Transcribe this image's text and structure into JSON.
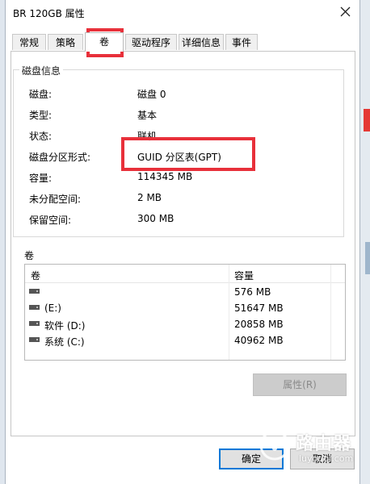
{
  "window": {
    "title": "BR 120GB 属性"
  },
  "tabs": [
    {
      "label": "常规"
    },
    {
      "label": "策略"
    },
    {
      "label": "卷"
    },
    {
      "label": "驱动程序"
    },
    {
      "label": "详细信息"
    },
    {
      "label": "事件"
    }
  ],
  "disk_info": {
    "legend": "磁盘信息",
    "rows": [
      {
        "label": "磁盘:",
        "value": "磁盘 0"
      },
      {
        "label": "类型:",
        "value": "基本"
      },
      {
        "label": "状态:",
        "value": "联机"
      },
      {
        "label": "磁盘分区形式:",
        "value": "GUID 分区表(GPT)"
      },
      {
        "label": "容量:",
        "value": "114345 MB"
      },
      {
        "label": "未分配空间:",
        "value": "2 MB"
      },
      {
        "label": "保留空间:",
        "value": "300 MB"
      }
    ]
  },
  "volumes": {
    "title": "卷",
    "headers": {
      "name": "卷",
      "capacity": "容量"
    },
    "rows": [
      {
        "name": "",
        "capacity": "576 MB"
      },
      {
        "name": "(E:)",
        "capacity": "51647 MB"
      },
      {
        "name": "软件 (D:)",
        "capacity": "20858 MB"
      },
      {
        "name": "系统 (C:)",
        "capacity": "40962 MB"
      }
    ],
    "properties_button": "属性(R)"
  },
  "buttons": {
    "ok": "确定",
    "cancel": "取消"
  },
  "watermark": {
    "text": "路由器",
    "sub": "luyouqi.com"
  },
  "colors": {
    "highlight": "#e8303a",
    "focus_border": "#0078d7"
  }
}
